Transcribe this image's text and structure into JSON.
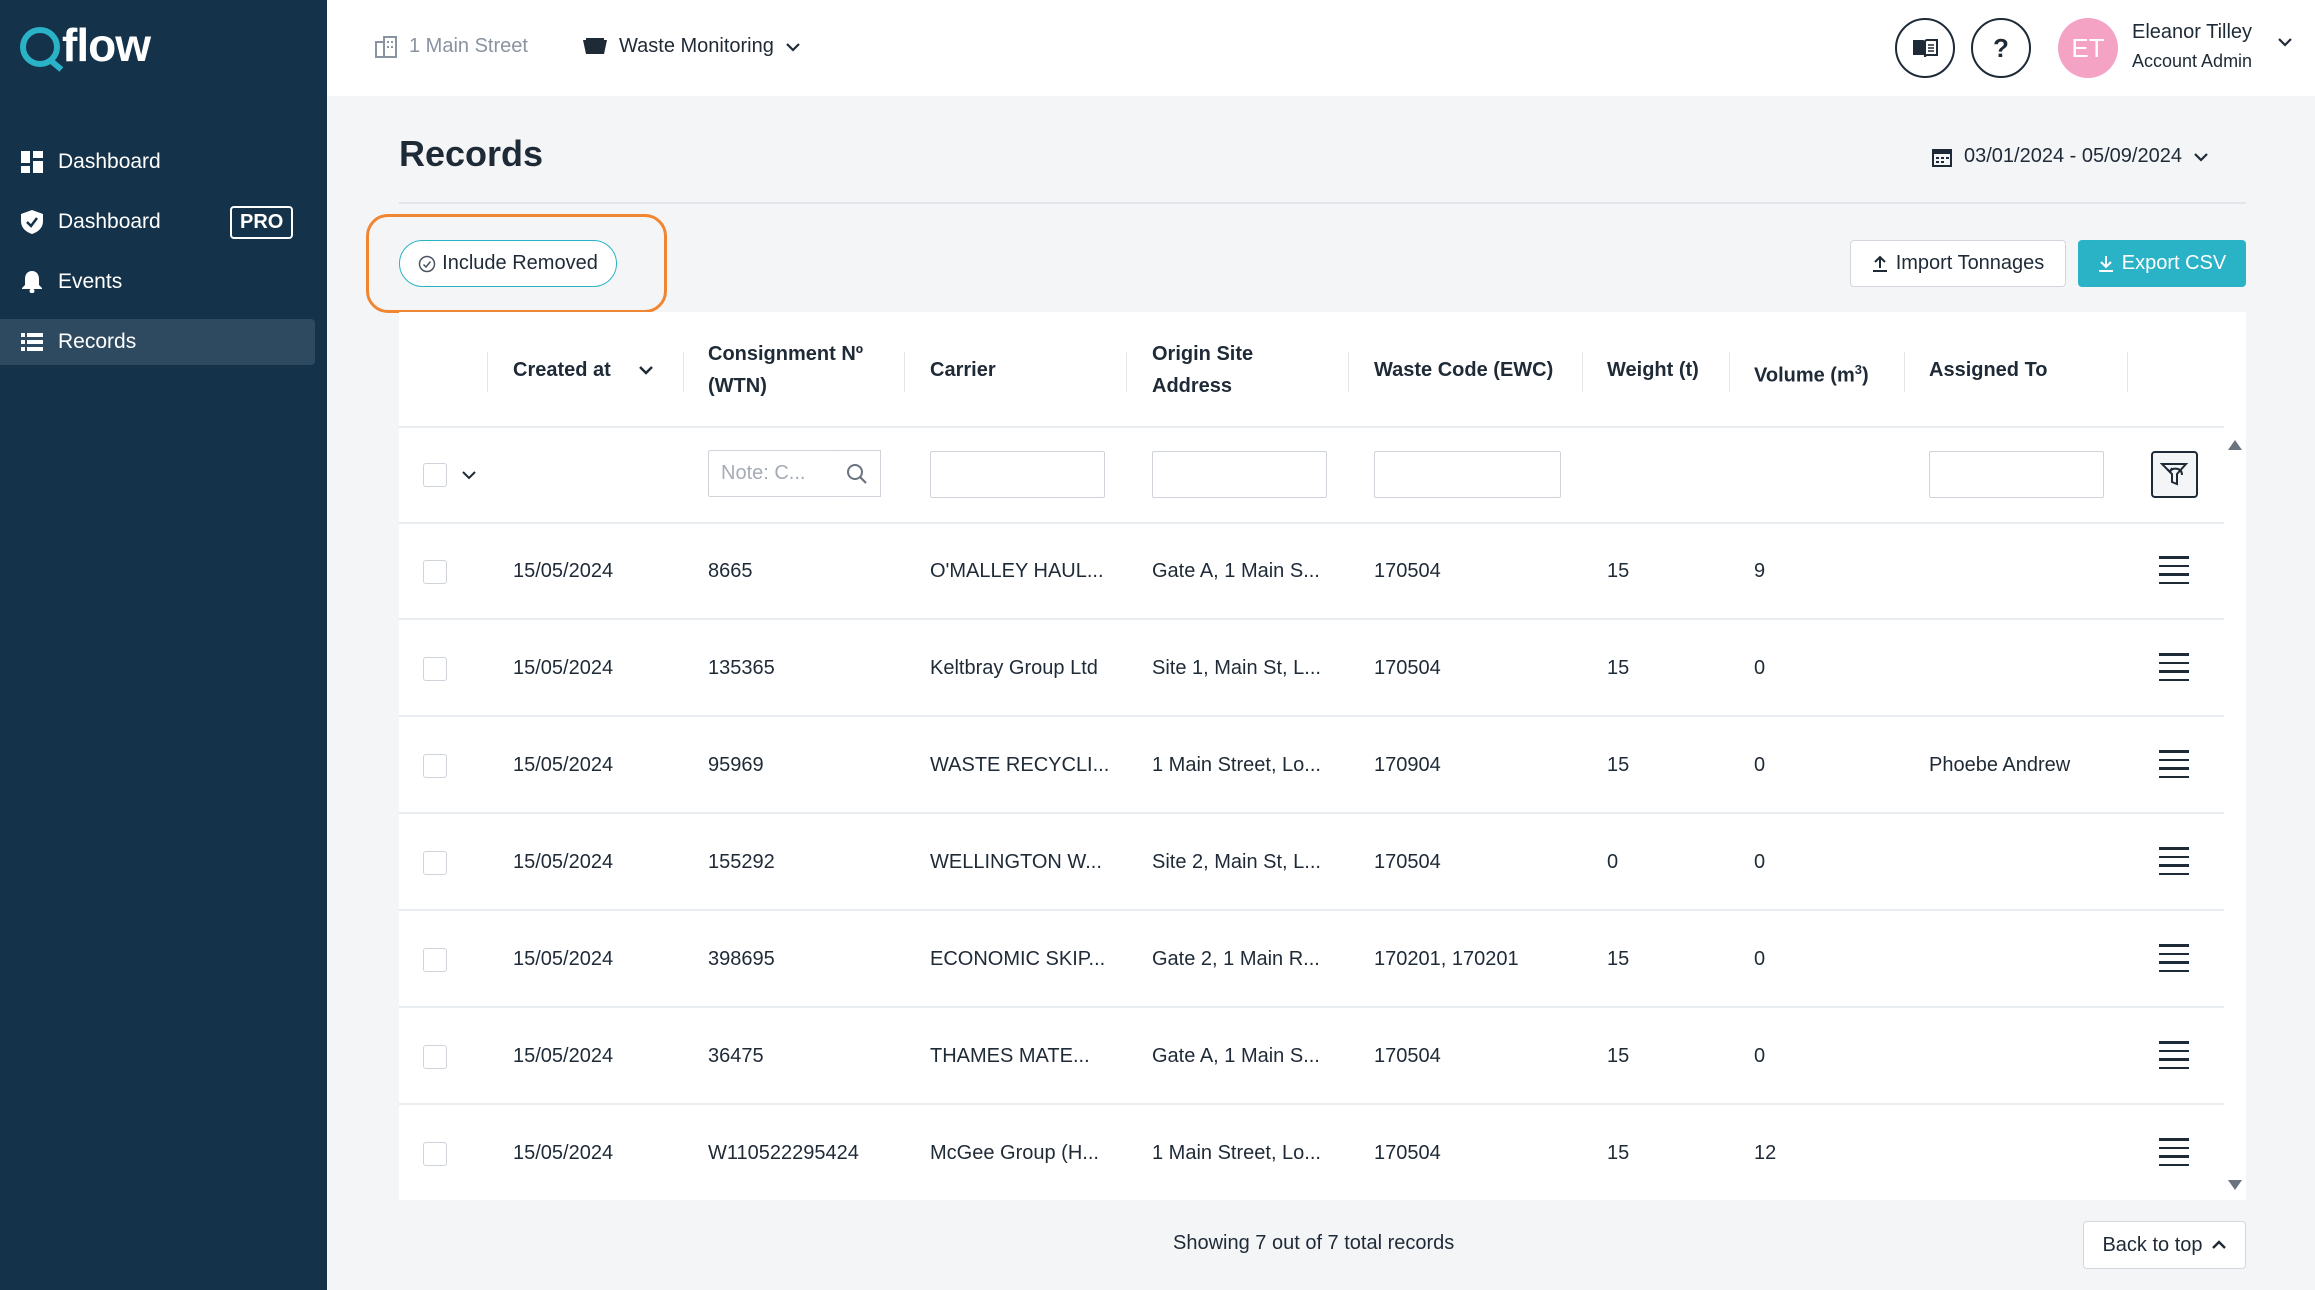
{
  "app": {
    "logo_text": "flow",
    "brand_color": "#2ab3c6",
    "sidebar_color": "#143249"
  },
  "sidebar": {
    "items": [
      {
        "label": "Dashboard",
        "icon": "dashboard-grid-icon"
      },
      {
        "label": "Dashboard",
        "icon": "shield-check-icon",
        "badge": "PRO"
      },
      {
        "label": "Events",
        "icon": "bell-icon"
      },
      {
        "label": "Records",
        "icon": "list-icon",
        "active": true
      }
    ]
  },
  "topbar": {
    "site": "1 Main Street",
    "module": "Waste Monitoring",
    "help_label": "?",
    "user": {
      "initials": "ET",
      "name": "Eleanor Tilley",
      "role": "Account Admin"
    }
  },
  "page": {
    "title": "Records",
    "date_range": "03/01/2024 - 05/09/2024",
    "include_removed_label": "Include Removed",
    "import_label": "Import Tonnages",
    "export_label": "Export CSV"
  },
  "table": {
    "headers": {
      "created_at": "Created at",
      "consignment_line1": "Consignment Nº",
      "consignment_line2": "(WTN)",
      "carrier": "Carrier",
      "origin_line1": "Origin Site",
      "origin_line2": "Address",
      "waste_code": "Waste Code (EWC)",
      "weight": "Weight (t)",
      "volume": "Volume (m",
      "volume_sup": "3",
      "volume_close": ")",
      "assigned_to": "Assigned To"
    },
    "filters": {
      "consignment_placeholder": "Note: C..."
    },
    "rows": [
      {
        "created": "15/05/2024",
        "consignment": "8665",
        "carrier": "O'MALLEY HAUL...",
        "origin": "Gate A, 1 Main S...",
        "ewc": "170504",
        "weight": "15",
        "volume": "9",
        "assigned": ""
      },
      {
        "created": "15/05/2024",
        "consignment": "135365",
        "carrier": "Keltbray Group Ltd",
        "origin": "Site 1, Main St, L...",
        "ewc": "170504",
        "weight": "15",
        "volume": "0",
        "assigned": ""
      },
      {
        "created": "15/05/2024",
        "consignment": "95969",
        "carrier": "WASTE RECYCLI...",
        "origin": "1 Main Street, Lo...",
        "ewc": "170904",
        "weight": "15",
        "volume": "0",
        "assigned": "Phoebe Andrew"
      },
      {
        "created": "15/05/2024",
        "consignment": "155292",
        "carrier": "WELLINGTON W...",
        "origin": "Site 2, Main St, L...",
        "ewc": "170504",
        "weight": "0",
        "volume": "0",
        "assigned": ""
      },
      {
        "created": "15/05/2024",
        "consignment": "398695",
        "carrier": "ECONOMIC SKIP...",
        "origin": "Gate 2, 1 Main R...",
        "ewc": "170201, 170201",
        "weight": "15",
        "volume": "0",
        "assigned": ""
      },
      {
        "created": "15/05/2024",
        "consignment": "36475",
        "carrier": "THAMES MATE...",
        "origin": "Gate A, 1 Main S...",
        "ewc": "170504",
        "weight": "15",
        "volume": "0",
        "assigned": ""
      },
      {
        "created": "15/05/2024",
        "consignment": "W110522295424",
        "carrier": "McGee Group (H...",
        "origin": "1 Main Street, Lo...",
        "ewc": "170504",
        "weight": "15",
        "volume": "12",
        "assigned": ""
      }
    ]
  },
  "footer": {
    "status": "Showing 7 out of 7 total records",
    "back_to_top": "Back to top"
  }
}
